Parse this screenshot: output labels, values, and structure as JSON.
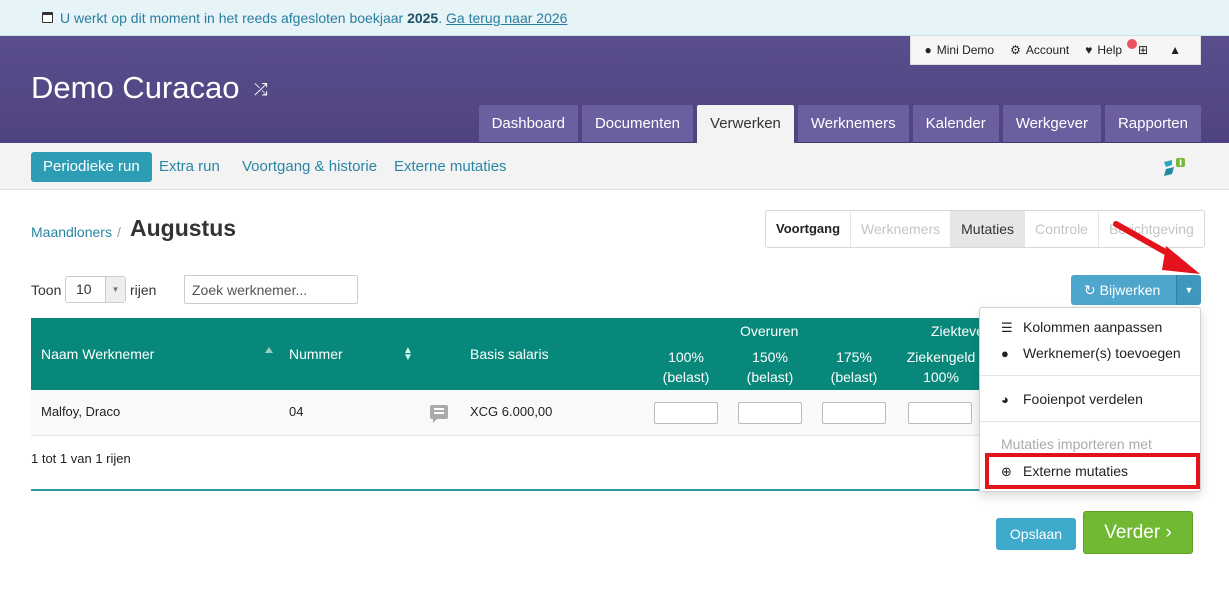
{
  "notice": {
    "text_before": "U werkt op dit moment in het reeds afgesloten boekjaar ",
    "year": "2025",
    "text_after": ". ",
    "link": "Ga terug naar 2026"
  },
  "header": {
    "company": "Demo Curacao",
    "userbar": {
      "user": "Mini Demo",
      "account": "Account",
      "help": "Help"
    },
    "tabs": [
      "Dashboard",
      "Documenten",
      "Verwerken",
      "Werknemers",
      "Kalender",
      "Werkgever",
      "Rapporten"
    ],
    "active_tab": "Verwerken"
  },
  "subnav": {
    "items": [
      "Periodieke run",
      "Extra run",
      "Voortgang & historie",
      "Externe mutaties"
    ]
  },
  "breadcrumb": {
    "parent": "Maandloners",
    "separator": "/",
    "title": "Augustus"
  },
  "steps": [
    "Voortgang",
    "Werknemers",
    "Mutaties",
    "Controle",
    "Berichtgeving"
  ],
  "controls": {
    "toon": "Toon",
    "page_length": "10",
    "rijen": "rijen",
    "search_placeholder": "Zoek werknemer...",
    "update_button": "Bijwerken"
  },
  "table": {
    "headers": {
      "name": "Naam Werknemer",
      "number": "Nummer",
      "salary": "Basis salaris",
      "overtime_group": "Overuren",
      "sick_group": "Ziekteve",
      "ot100_line1": "100%",
      "ot100_line2": "(belast)",
      "ot150_line1": "150%",
      "ot150_line2": "(belast)",
      "ot175_line1": "175%",
      "ot175_line2": "(belast)",
      "sick_line1": "Ziekengeld",
      "sick_line2": "100%"
    },
    "rows": [
      {
        "name": "Malfoy, Draco",
        "number": "04",
        "salary": "XCG 6.000,00"
      }
    ],
    "info": "1 tot 1 van 1 rijen"
  },
  "footer": {
    "save": "Opslaan",
    "next": "Verder"
  },
  "dropdown": {
    "columns": "Kolommen aanpassen",
    "add_employee": "Werknemer(s) toevoegen",
    "tip_pool": "Fooienpot verdelen",
    "import_header": "Mutaties importeren met",
    "external": "Externe mutaties"
  },
  "colors": {
    "brand": "#5a4d8c",
    "table_header": "#08887a",
    "primary": "#2d9db5",
    "success": "#71b833",
    "highlight": "#e3121b"
  }
}
